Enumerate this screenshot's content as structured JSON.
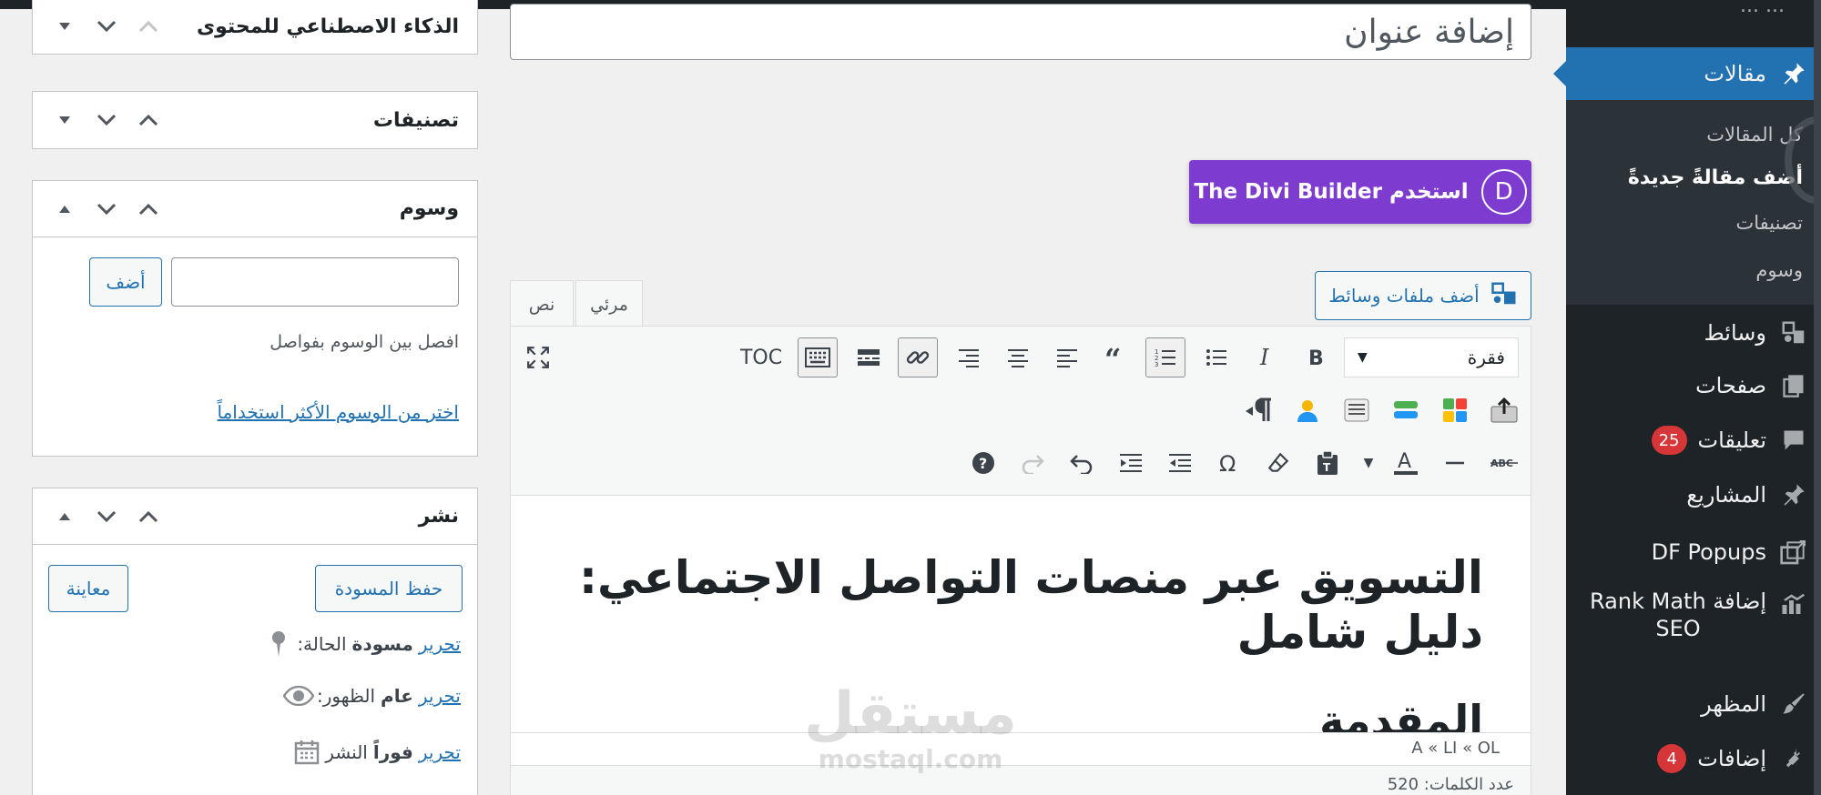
{
  "sidebar": {
    "cut_top_label": "... ...",
    "posts_label": "مقالات",
    "submenu": [
      "كل المقالات",
      "أضف مقالةً جديدةً",
      "تصنيفات",
      "وسوم"
    ],
    "media_label": "وسائط",
    "pages_label": "صفحات",
    "comments_label": "تعليقات",
    "comments_count": "25",
    "projects_label": "المشاريع",
    "popups_label": "DF Popups",
    "rankmath_label_1": "إضافة Rank Math",
    "rankmath_label_2": "SEO",
    "appearance_label": "المظهر",
    "plugins_label": "إضافات",
    "plugins_count": "4"
  },
  "editor": {
    "title_placeholder": "إضافة عنوان",
    "divi_label": "استخدم The Divi Builder",
    "divi_logo": "D",
    "add_media_label": "أضف ملفات وسائط",
    "tab_visual": "مرئي",
    "tab_text": "نص",
    "format_value": "فقرة",
    "toc_label": "TOC",
    "heading1": "التسويق عبر منصات التواصل الاجتماعي: دليل شامل",
    "heading2": "المقدمة",
    "path": "A « LI « OL",
    "word_count": "عدد الكلمات: 520"
  },
  "watermark": {
    "ar": "مستقل",
    "en": "mostaql.com"
  },
  "boxes": {
    "ai_title": "الذكاء الاصطناعي للمحتوى",
    "categories_title": "تصنيفات",
    "tags_title": "وسوم",
    "tags_add": "أضف",
    "tags_hint": "افصل بين الوسوم بفواصل",
    "tags_choose": "اختر من الوسوم الأكثر استخداماً",
    "publish_title": "نشر",
    "save_draft": "حفظ المسودة",
    "preview": "معاينة",
    "status_label": "الحالة:",
    "status_value": "مسودة",
    "visibility_label": "الظهور:",
    "visibility_value": "عام",
    "publish_label": "النشر",
    "publish_value": "فوراً",
    "edit": "تحرير"
  },
  "colors": {
    "accent": "#2271b1",
    "divi": "#7e3bd0",
    "sidebar": "#1d2327",
    "badge": "#d63638"
  }
}
